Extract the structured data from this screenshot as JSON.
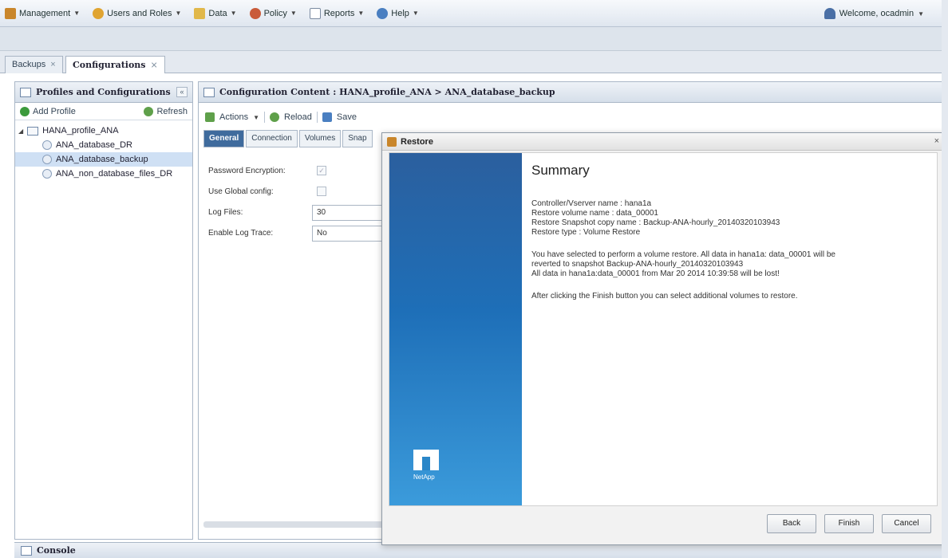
{
  "menubar": {
    "items": [
      {
        "label": "Management",
        "icon": "wrench-icon",
        "color": "#c9862b"
      },
      {
        "label": "Users and Roles",
        "icon": "users-icon",
        "color": "#e0a431"
      },
      {
        "label": "Data",
        "icon": "data-icon",
        "color": "#e1b84a"
      },
      {
        "label": "Policy",
        "icon": "policy-icon",
        "color": "#c95b3a"
      },
      {
        "label": "Reports",
        "icon": "reports-icon",
        "color": "#7a8aa0"
      },
      {
        "label": "Help",
        "icon": "help-icon",
        "color": "#4a7fc1"
      }
    ],
    "welcome": "Welcome, ocadmin"
  },
  "main_tabs": [
    {
      "label": "Backups"
    },
    {
      "label": "Configurations"
    }
  ],
  "left_panel": {
    "title": "Profiles and Configurations",
    "add_profile": "Add Profile",
    "refresh": "Refresh",
    "tree": [
      {
        "label": "HANA_profile_ANA"
      },
      {
        "label": "ANA_database_DR"
      },
      {
        "label": "ANA_database_backup"
      },
      {
        "label": "ANA_non_database_files_DR"
      }
    ]
  },
  "right_panel": {
    "title": "Configuration Content : HANA_profile_ANA > ANA_database_backup",
    "actions": "Actions",
    "reload": "Reload",
    "save": "Save",
    "tabs": [
      "General",
      "Connection",
      "Volumes",
      "Snap"
    ],
    "form": {
      "password_encryption": "Password Encryption:",
      "use_global_config": "Use Global config:",
      "log_files": "Log Files:",
      "log_files_value": "30",
      "enable_log_trace": "Enable Log Trace:",
      "enable_log_trace_value": "No"
    }
  },
  "console": {
    "label": "Console"
  },
  "dialog": {
    "title": "Restore",
    "close": "×",
    "summary": "Summary",
    "details": [
      "Controller/Vserver name : hana1a",
      "Restore volume name : data_00001",
      "Restore Snapshot copy name : Backup-ANA-hourly_20140320103943",
      "Restore type : Volume Restore"
    ],
    "warning": [
      "You have selected to perform a volume restore. All data in hana1a: data_00001 will be",
      "reverted to snapshot Backup-ANA-hourly_20140320103943",
      "All data in hana1a:data_00001 from Mar 20 2014 10:39:58 will be lost!"
    ],
    "note": "After clicking the Finish button you can select additional volumes to restore.",
    "logo_text": "NetApp",
    "buttons": {
      "back": "Back",
      "finish": "Finish",
      "cancel": "Cancel"
    }
  }
}
